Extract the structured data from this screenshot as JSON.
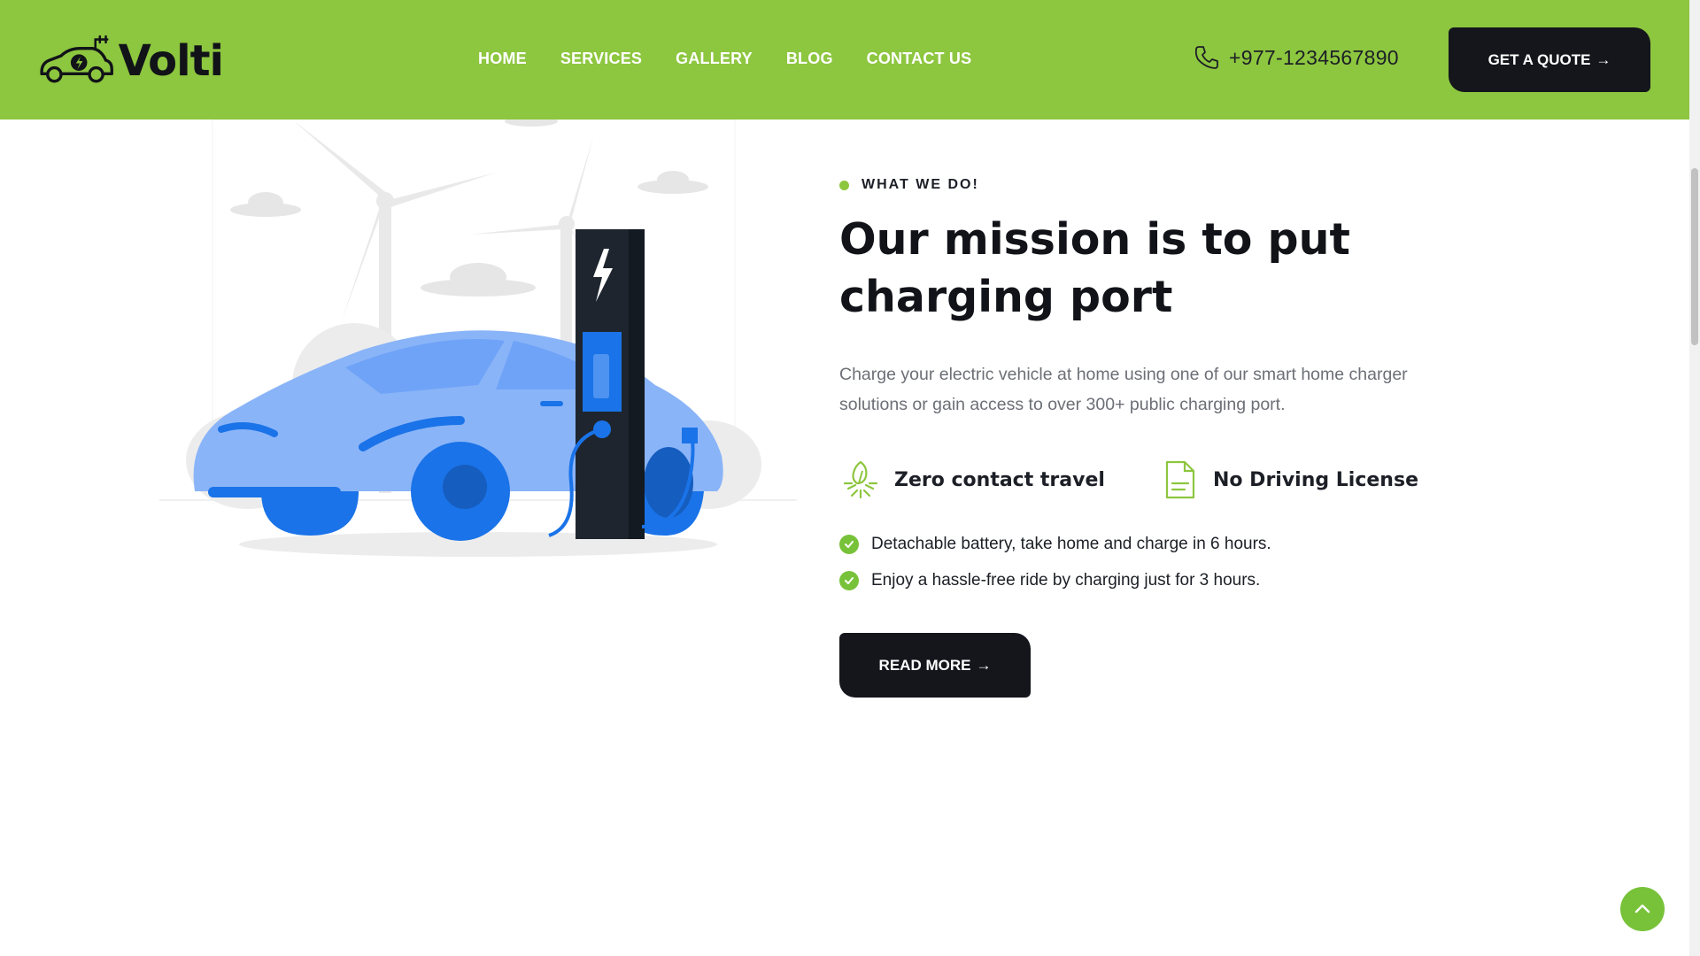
{
  "header": {
    "logo_text": "Volti",
    "nav": [
      {
        "label": "HOME"
      },
      {
        "label": "SERVICES"
      },
      {
        "label": "GALLERY"
      },
      {
        "label": "BLOG"
      },
      {
        "label": "CONTACT US"
      }
    ],
    "phone": "+977-1234567890",
    "quote_button": "GET A QUOTE",
    "arrow": "→"
  },
  "about": {
    "eyebrow": "WHAT WE DO!",
    "heading": "Our mission is to put charging port",
    "description": "Charge your electric vehicle at home using one of our smart home charger solutions or gain access to over 300+ public charging port.",
    "features": [
      {
        "label": "Zero contact travel",
        "icon": "eco-leaf-icon"
      },
      {
        "label": "No Driving License",
        "icon": "document-icon"
      }
    ],
    "checklist": [
      {
        "text": "Detachable battery, take home and charge in 6 hours."
      },
      {
        "text": "Enjoy a hassle-free ride by charging just for 3 hours."
      }
    ],
    "read_more": "READ MORE"
  },
  "colors": {
    "brand_green": "#8dc63f",
    "dark": "#14161c",
    "car_blue": "#8ab4f8",
    "car_dark_blue": "#1a73e8"
  }
}
